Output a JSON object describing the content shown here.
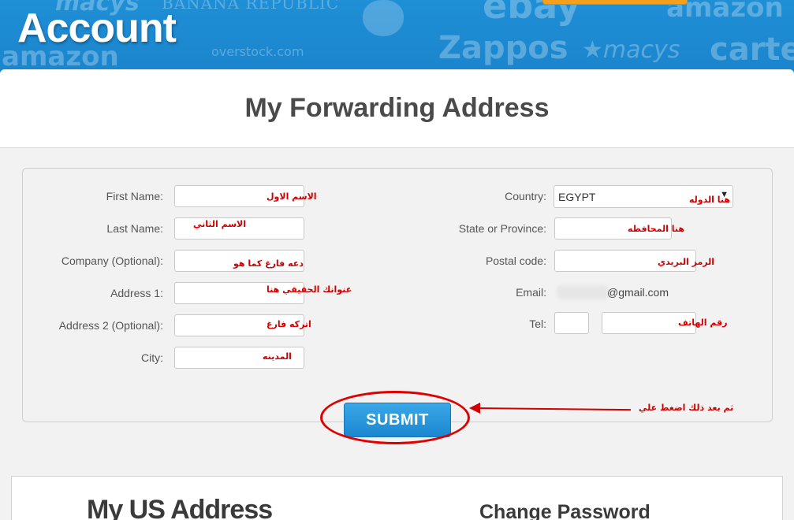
{
  "banner": {
    "title": "Account",
    "brands": [
      "macys",
      "BANANA REPUBLIC",
      "ebay",
      "amazon",
      "amazon",
      "overstock.com",
      "Zappos",
      "★macys",
      "carte"
    ]
  },
  "card": {
    "title": "My Forwarding Address"
  },
  "form": {
    "left": [
      {
        "label": "First Name:",
        "value": "",
        "note": "الاسم الاول"
      },
      {
        "label": "Last Name:",
        "value": "",
        "note": "الاسم الثاني"
      },
      {
        "label": "Company (Optional):",
        "value": "",
        "note": "دعه فارغ كما هو"
      },
      {
        "label": "Address 1:",
        "value": "",
        "note": "عنوانك الحقيقي هنا"
      },
      {
        "label": "Address 2 (Optional):",
        "value": "",
        "note": "اتركه فارغ"
      },
      {
        "label": "City:",
        "value": "",
        "note": "المدينه"
      }
    ],
    "country": {
      "label": "Country:",
      "value": "EGYPT",
      "note": "هنا الدوله"
    },
    "state": {
      "label": "State or Province:",
      "value": "",
      "note": "هنا المحافظه"
    },
    "postal": {
      "label": "Postal code:",
      "value": "",
      "note": "الرمز البريدي"
    },
    "email": {
      "label": "Email:",
      "value": "@gmail.com"
    },
    "tel": {
      "label": "Tel:",
      "code": "",
      "number": "",
      "note": "رقم الهاتف"
    },
    "submit_label": "SUBMIT",
    "submit_note": "ثم بعد ذلك اضغط علي"
  },
  "bottom": {
    "us_address_title": "My US Address",
    "change_password_title": "Change Password"
  },
  "colors": {
    "banner": "#1f8fd6",
    "annotation": "#d00000",
    "submit": "#2496dc"
  }
}
